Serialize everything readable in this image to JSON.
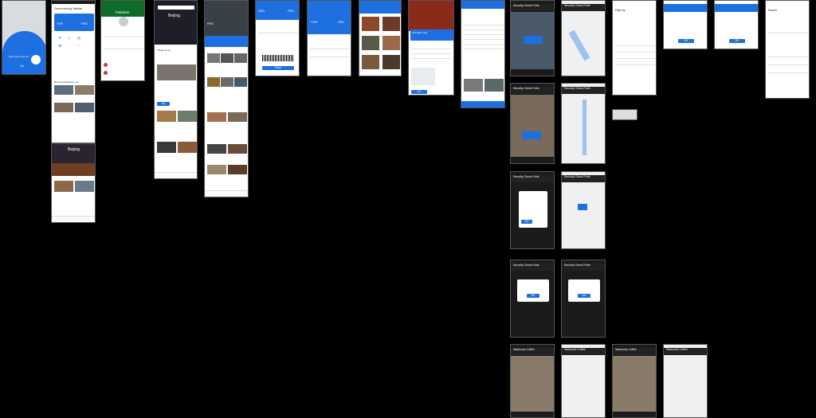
{
  "home": {
    "title": "Good evening, Nathan",
    "card_from": "YVR",
    "card_to": "PEK",
    "section": "Recommended for you"
  },
  "pakistan": {
    "country": "Pakistan"
  },
  "beijing": {
    "city": "Beijing",
    "section": "Things to do"
  },
  "beijing2": {
    "city": "Beijing"
  },
  "flight_a": {
    "from": "SEA",
    "to": "PEK"
  },
  "flight_b": {
    "from": "YVR",
    "to": "PEK"
  },
  "palace": {
    "title": "Forbidden City"
  },
  "nav": {
    "title": "Security Check Point"
  },
  "coffee": {
    "title": "Starbucks Coffee"
  },
  "modal": {
    "ok": "OK"
  },
  "filter": {
    "title": "Filter by"
  },
  "search": {
    "title": "Search"
  },
  "colors": {
    "accent": "#1e6fe0",
    "dark": "#1b1b1b"
  }
}
